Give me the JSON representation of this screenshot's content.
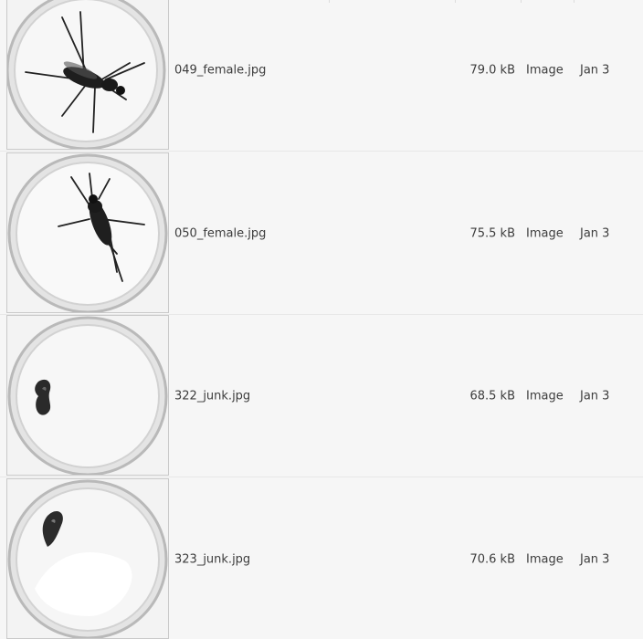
{
  "files": [
    {
      "name": "049_female.jpg",
      "size": "79.0 kB",
      "type": "Image",
      "modified": "Jan 3",
      "thumbnail_icon": "mosquito-female-thumbnail-icon"
    },
    {
      "name": "050_female.jpg",
      "size": "75.5 kB",
      "type": "Image",
      "modified": "Jan 3",
      "thumbnail_icon": "mosquito-female-thumbnail-icon"
    },
    {
      "name": "322_junk.jpg",
      "size": "68.5 kB",
      "type": "Image",
      "modified": "Jan 3",
      "thumbnail_icon": "debris-thumbnail-icon"
    },
    {
      "name": "323_junk.jpg",
      "size": "70.6 kB",
      "type": "Image",
      "modified": "Jan 3",
      "thumbnail_icon": "debris-thumbnail-icon"
    }
  ]
}
